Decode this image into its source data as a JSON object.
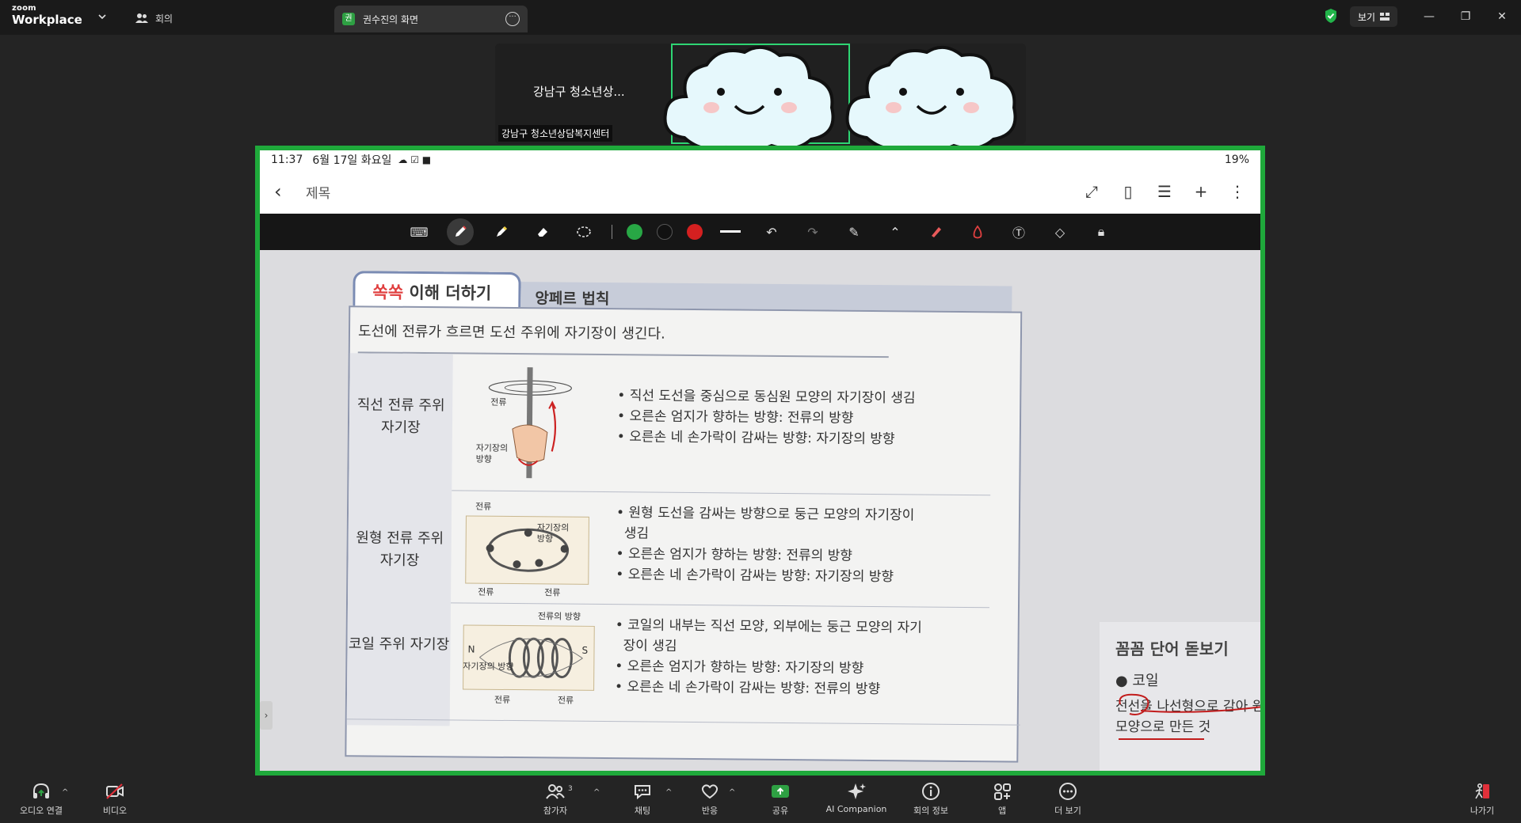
{
  "app": {
    "brand_top": "zoom",
    "brand_bottom": "Workplace",
    "meeting_tab_label": "회의",
    "share_tab_label": "권수진의 화면",
    "share_tab_badge": "권",
    "view_button_label": "보기",
    "accent_color": "#1fa93b"
  },
  "video": {
    "tile1_name": "강남구 청소년상...",
    "tile1_caption": "강남구 청소년상담복지센터"
  },
  "screen": {
    "status_time": "11:37",
    "status_date": "6월 17일 화요일",
    "status_battery": "19%",
    "note_title": "제목",
    "pen_colors": [
      "#28a745",
      "#111111",
      "#d42020"
    ],
    "page": {
      "tab_highlight": "쏙쏙",
      "tab_rest": " 이해 더하기",
      "tab_topic": "앙페르 법칙",
      "lead": "도선에 전류가 흐르면 도선 주위에 자기장이 생긴다.",
      "rows": [
        {
          "title": "직선 전류 주위 자기장",
          "fig_labels": [
            "전류",
            "자기장의 방향"
          ],
          "lines": [
            "• 직선 도선을 중심으로 동심원 모양의 자기장이 생김",
            "• 오른손 엄지가 향하는 방향: 전류의 방향",
            "• 오른손 네 손가락이 감싸는 방향: 자기장의 방향"
          ]
        },
        {
          "title": "원형 전류 주위 자기장",
          "fig_labels": [
            "전류",
            "자기장의 방향",
            "전류",
            "전류"
          ],
          "lines": [
            "• 원형 도선을 감싸는 방향으로 둥근 모양의 자기장이",
            "생김",
            "• 오른손 엄지가 향하는 방향: 전류의 방향",
            "• 오른손 네 손가락이 감싸는 방향: 자기장의 방향"
          ]
        },
        {
          "title": "코일 주위 자기장",
          "fig_labels": [
            "전류의 방향",
            "N",
            "S",
            "자기장의 방향",
            "전류",
            "전류"
          ],
          "lines": [
            "• 코일의 내부는 직선 모양, 외부에는 둥근 모양의 자기",
            "장이 생김",
            "• 오른손 엄지가 향하는 방향: 자기장의 방향",
            "• 오른손 네 손가락이 감싸는 방향: 전류의 방향"
          ]
        }
      ],
      "side_header": "꼼꼼 단어 돋보기",
      "side_word": "● 코일",
      "side_def_1": "전선을 나선형으로 감아 원",
      "side_def_2": "모양으로 만든 것"
    }
  },
  "toolbar": {
    "audio": "오디오 연결",
    "video": "비디오",
    "participants": "참가자",
    "participants_count": "3",
    "chat": "채팅",
    "reactions": "반응",
    "share": "공유",
    "ai": "AI Companion",
    "info": "회의 정보",
    "apps": "앱",
    "more": "더 보기",
    "leave": "나가기"
  }
}
